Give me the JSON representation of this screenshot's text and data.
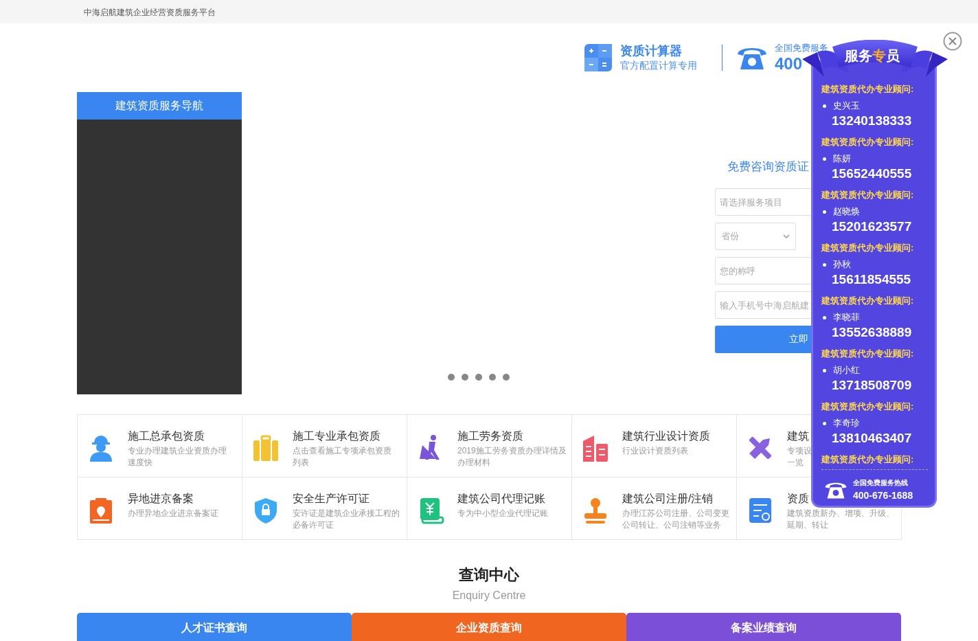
{
  "top_bar": {
    "site_name": "中海启航建筑企业经营资质服务平台"
  },
  "header": {
    "calculator": {
      "title": "资质计算器",
      "subtitle": "官方配置计算专用"
    },
    "hotline": {
      "label": "全国免费服务",
      "number": "400"
    }
  },
  "nav_panel": {
    "title": "建筑资质服务导航"
  },
  "form": {
    "title": "免费咨询资质证",
    "service_placeholder": "请选择服务项目",
    "province_placeholder": "省份",
    "name_placeholder": "您的称呼",
    "phone_placeholder": "输入手机号中海启航建",
    "submit": "立即"
  },
  "services": [
    {
      "title": "施工总承包资质",
      "desc": [
        "专业办理建筑企业资质办理",
        "速度快"
      ]
    },
    {
      "title": "施工专业承包资质",
      "desc": [
        "点击查看施工专项承包资质",
        "列表"
      ]
    },
    {
      "title": "施工劳务资质",
      "desc": [
        "2019施工劳务资质办理详情及",
        "办理材料"
      ]
    },
    {
      "title": "建筑行业设计资质",
      "desc": [
        "行业设计资质列表"
      ]
    },
    {
      "title": "建筑",
      "desc": [
        "专项设",
        "一览"
      ]
    },
    {
      "title": "异地进京备案",
      "desc": [
        "办理异地企业进京备案证"
      ]
    },
    {
      "title": "安全生产许可证",
      "desc": [
        "安许证是建筑企业承接工程的",
        "必备许可证"
      ]
    },
    {
      "title": "建筑公司代理记账",
      "desc": [
        "专为中小型企业代理记账"
      ]
    },
    {
      "title": "建筑公司注册/注销",
      "desc": [
        "办理江苏公司注册、公司变更",
        "公司转让、公司注销等业务"
      ]
    },
    {
      "title": "资质",
      "desc": [
        "建筑资质新办、增项、升级、",
        "延期、转让"
      ]
    }
  ],
  "enquiry": {
    "title": "查询中心",
    "subtitle": "Enquiry Centre",
    "tabs": [
      {
        "label": "人才证书查询",
        "color": "#3a86f0"
      },
      {
        "label": "企业资质查询",
        "color": "#f0651f"
      },
      {
        "label": "备案业绩查询",
        "color": "#7c4fd8"
      }
    ]
  },
  "service_popup": {
    "title_parts": [
      {
        "text": "服务",
        "highlight": false
      },
      {
        "text": "专",
        "highlight": true
      },
      {
        "text": "员",
        "highlight": false
      }
    ],
    "advisors": [
      {
        "label": "建筑资质代办专业顾问:",
        "name": "史兴玉",
        "phone": "13240138333"
      },
      {
        "label": "建筑资质代办专业顾问:",
        "name": "陈妍",
        "phone": "15652440555"
      },
      {
        "label": "建筑资质代办专业顾问:",
        "name": "赵晓焕",
        "phone": "15201623577"
      },
      {
        "label": "建筑资质代办专业顾问:",
        "name": "孙秋",
        "phone": "15611854555"
      },
      {
        "label": "建筑资质代办专业顾问:",
        "name": "李晓菲",
        "phone": "13552638889"
      },
      {
        "label": "建筑资质代办专业顾问:",
        "name": "胡小红",
        "phone": "13718508709"
      },
      {
        "label": "建筑资质代办专业顾问:",
        "name": "李奇珍",
        "phone": "13810463407"
      }
    ],
    "last_label": "建筑资质代办专业顾问:",
    "hotline_label": "全国免费服务热线",
    "hotline_number": "400-676-1688"
  }
}
